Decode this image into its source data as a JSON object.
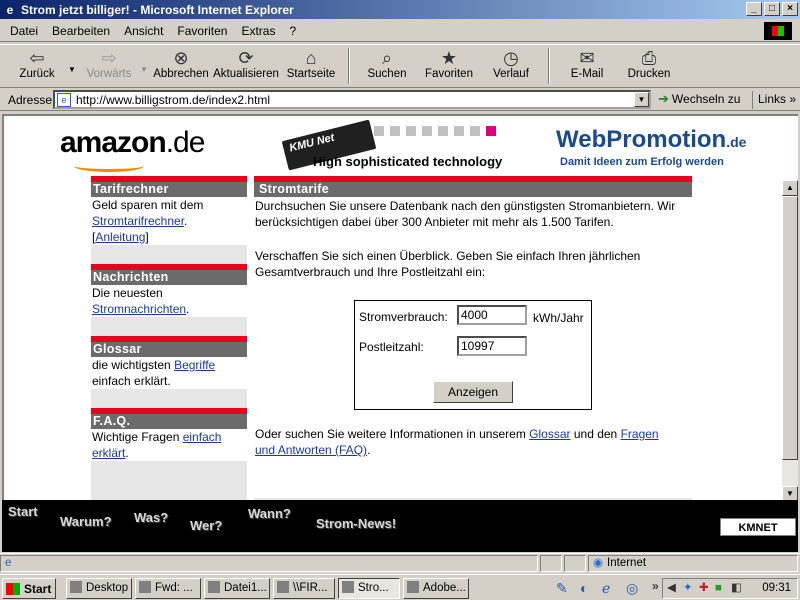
{
  "window": {
    "title": "Strom jetzt billiger! - Microsoft Internet Explorer",
    "btn_min": "_",
    "btn_max": "□",
    "btn_close": "×"
  },
  "menu": [
    "Datei",
    "Bearbeiten",
    "Ansicht",
    "Favoriten",
    "Extras",
    "?"
  ],
  "toolbar": {
    "back": "Zurück",
    "forward": "Vorwärts",
    "stop": "Abbrechen",
    "refresh": "Aktualisieren",
    "home": "Startseite",
    "search": "Suchen",
    "favorites": "Favoriten",
    "history": "Verlauf",
    "mail": "E-Mail",
    "print": "Drucken"
  },
  "address": {
    "label": "Adresse",
    "url": "http://www.billigstrom.de/index2.html",
    "go": "Wechseln zu",
    "links": "Links"
  },
  "header": {
    "amazon_name": "amazon",
    "amazon_tld": ".de",
    "kmu_logo": "KMU Net",
    "tagline": "High sophisticated technology",
    "wp_name": "WebPromotion",
    "wp_tld": ".de",
    "wp_slogan": "Damit Ideen zum Erfolg werden"
  },
  "sidebar": {
    "tarif": {
      "title": "Tarifrechner",
      "text1": "Geld sparen mit dem",
      "link1": "Stromtarifrechner",
      "after1": ".",
      "bracket_open": "[",
      "link2": "Anleitung",
      "bracket_close": "]"
    },
    "news": {
      "title": "Nachrichten",
      "text1": "Die neuesten",
      "link1": "Stromnachrichten",
      "after1": "."
    },
    "glossar": {
      "title": "Glossar",
      "text1": "die wichtigsten",
      "link1": "Begriffe",
      "text2": "einfach erklärt."
    },
    "faq": {
      "title": "F.A.Q.",
      "text1": "Wichtige Fragen",
      "link1a": "einfach",
      "link1b": "erklärt",
      "after1": "."
    }
  },
  "main": {
    "title": "Stromtarife",
    "p1": "Durchsuchen Sie unsere Datenbank nach den günstigsten Stromanbietern. Wir berücksichtigen dabei über 300 Anbieter mit mehr als 1.500 Tarifen.",
    "p2": "Verschaffen Sie sich einen Überblick. Geben Sie einfach Ihren jährlichen Gesamtverbrauch und Ihre Postleitzahl ein:",
    "form": {
      "usage_label": "Stromverbrauch:",
      "usage_value": "4000",
      "usage_unit": "kWh/Jahr",
      "zip_label": "Postleitzahl:",
      "zip_value": "10997",
      "submit": "Anzeigen"
    },
    "p3_pre": "Oder suchen Sie weitere Informationen in unserem",
    "p3_link1": "Glossar",
    "p3_mid": "und den",
    "p3_link2a": "Fragen",
    "p3_link2b": "und Antworten (FAQ)",
    "p3_post": "."
  },
  "nav": {
    "start": "Start",
    "warum": "Warum?",
    "was": "Was?",
    "wer": "Wer?",
    "wann": "Wann?",
    "news": "Strom-News!",
    "brand": "KMNET"
  },
  "status": {
    "zone": "Internet"
  },
  "taskbar": {
    "start": "Start",
    "tasks": [
      "Desktop",
      "Fwd: ...",
      "Datei1...",
      "\\\\FIR...",
      "Stro...",
      "Adobe..."
    ],
    "clock": "09:31",
    "more": "»"
  },
  "colors": {
    "accent_red": "#e8001e",
    "header_gray": "#6b6b6b",
    "link_blue": "#1a3a9c"
  }
}
